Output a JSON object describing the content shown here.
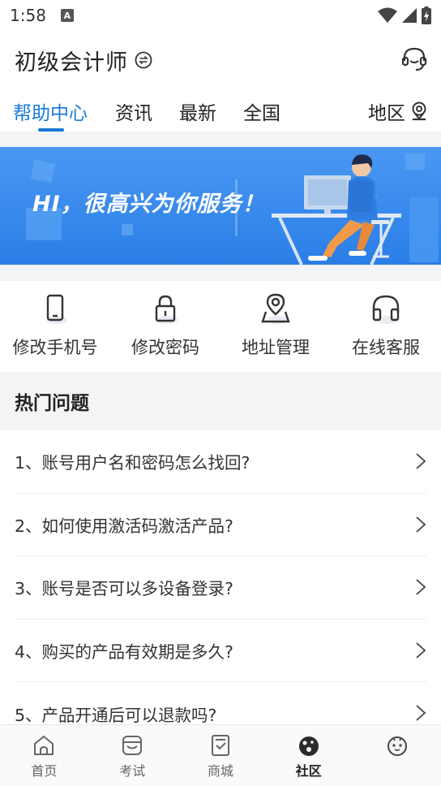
{
  "status_bar": {
    "time": "1:58",
    "notification_letter": "A"
  },
  "header": {
    "title": "初级会计师"
  },
  "tabs": [
    {
      "label": "帮助中心",
      "active": true
    },
    {
      "label": "资讯",
      "active": false
    },
    {
      "label": "最新",
      "active": false
    },
    {
      "label": "全国",
      "active": false
    }
  ],
  "region_label": "地区",
  "banner": {
    "text": "HI，很高兴为你服务！"
  },
  "quick_actions": [
    {
      "label": "修改手机号",
      "icon": "phone-icon"
    },
    {
      "label": "修改密码",
      "icon": "lock-icon"
    },
    {
      "label": "地址管理",
      "icon": "location-icon"
    },
    {
      "label": "在线客服",
      "icon": "headset-icon"
    }
  ],
  "hot_questions": {
    "title": "热门问题",
    "items": [
      "1、账号用户名和密码怎么找回?",
      "2、如何使用激活码激活产品?",
      "3、账号是否可以多设备登录?",
      "4、购买的产品有效期是多久?",
      "5、产品开通后可以退款吗?"
    ]
  },
  "bottom_nav": [
    {
      "label": "首页",
      "icon": "home-icon",
      "active": false
    },
    {
      "label": "考试",
      "icon": "exam-icon",
      "active": false
    },
    {
      "label": "商城",
      "icon": "shop-icon",
      "active": false
    },
    {
      "label": "社区",
      "icon": "community-icon",
      "active": true
    },
    {
      "label": "",
      "icon": "mascot-icon",
      "active": false
    }
  ],
  "colors": {
    "accent": "#1a7ad9",
    "banner": "#2d84ea",
    "divider": "#f3f4f6"
  }
}
